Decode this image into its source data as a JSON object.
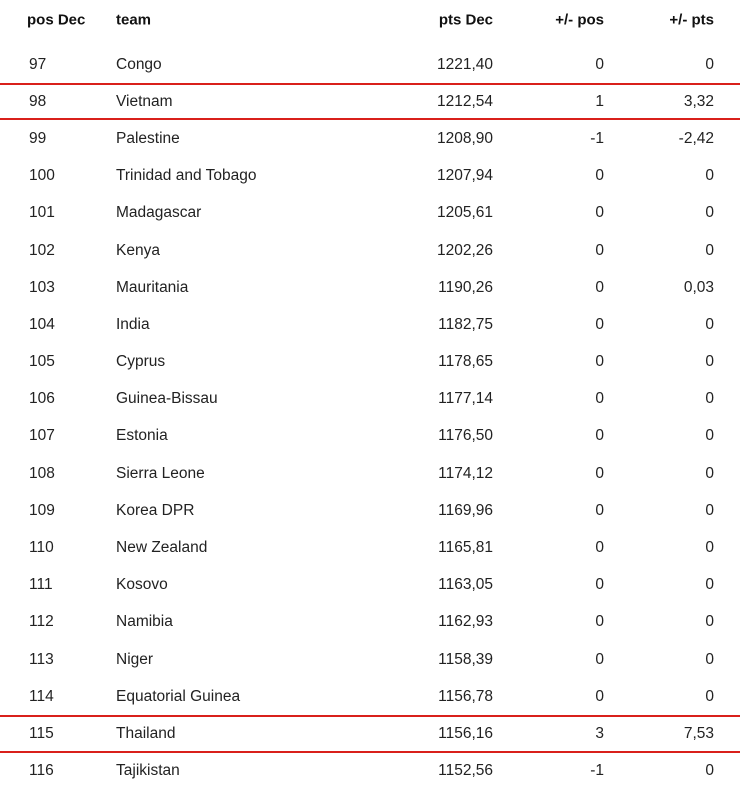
{
  "header": {
    "pos": "pos Dec",
    "team": "team",
    "pts": "pts Dec",
    "dpos": "+/- pos",
    "dpts": "+/- pts"
  },
  "accent_color": "#d9201b",
  "rows": [
    {
      "pos": "97",
      "team": "Congo",
      "pts": "1221,40",
      "dpos": "0",
      "dpts": "0",
      "highlight": false
    },
    {
      "pos": "98",
      "team": "Vietnam",
      "pts": "1212,54",
      "dpos": "1",
      "dpts": "3,32",
      "highlight": true
    },
    {
      "pos": "99",
      "team": "Palestine",
      "pts": "1208,90",
      "dpos": "-1",
      "dpts": "-2,42",
      "highlight": false
    },
    {
      "pos": "100",
      "team": "Trinidad and Tobago",
      "pts": "1207,94",
      "dpos": "0",
      "dpts": "0",
      "highlight": false
    },
    {
      "pos": "101",
      "team": "Madagascar",
      "pts": "1205,61",
      "dpos": "0",
      "dpts": "0",
      "highlight": false
    },
    {
      "pos": "102",
      "team": "Kenya",
      "pts": "1202,26",
      "dpos": "0",
      "dpts": "0",
      "highlight": false
    },
    {
      "pos": "103",
      "team": "Mauritania",
      "pts": "1190,26",
      "dpos": "0",
      "dpts": "0,03",
      "highlight": false
    },
    {
      "pos": "104",
      "team": "India",
      "pts": "1182,75",
      "dpos": "0",
      "dpts": "0",
      "highlight": false
    },
    {
      "pos": "105",
      "team": "Cyprus",
      "pts": "1178,65",
      "dpos": "0",
      "dpts": "0",
      "highlight": false
    },
    {
      "pos": "106",
      "team": "Guinea-Bissau",
      "pts": "1177,14",
      "dpos": "0",
      "dpts": "0",
      "highlight": false
    },
    {
      "pos": "107",
      "team": "Estonia",
      "pts": "1176,50",
      "dpos": "0",
      "dpts": "0",
      "highlight": false
    },
    {
      "pos": "108",
      "team": "Sierra Leone",
      "pts": "1174,12",
      "dpos": "0",
      "dpts": "0",
      "highlight": false
    },
    {
      "pos": "109",
      "team": "Korea DPR",
      "pts": "1169,96",
      "dpos": "0",
      "dpts": "0",
      "highlight": false
    },
    {
      "pos": "110",
      "team": "New Zealand",
      "pts": "1165,81",
      "dpos": "0",
      "dpts": "0",
      "highlight": false
    },
    {
      "pos": "111",
      "team": "Kosovo",
      "pts": "1163,05",
      "dpos": "0",
      "dpts": "0",
      "highlight": false
    },
    {
      "pos": "112",
      "team": "Namibia",
      "pts": "1162,93",
      "dpos": "0",
      "dpts": "0",
      "highlight": false
    },
    {
      "pos": "113",
      "team": "Niger",
      "pts": "1158,39",
      "dpos": "0",
      "dpts": "0",
      "highlight": false
    },
    {
      "pos": "114",
      "team": "Equatorial Guinea",
      "pts": "1156,78",
      "dpos": "0",
      "dpts": "0",
      "highlight": false
    },
    {
      "pos": "115",
      "team": "Thailand",
      "pts": "1156,16",
      "dpos": "3",
      "dpts": "7,53",
      "highlight": true
    },
    {
      "pos": "116",
      "team": "Tajikistan",
      "pts": "1152,56",
      "dpos": "-1",
      "dpts": "0",
      "highlight": false
    }
  ]
}
